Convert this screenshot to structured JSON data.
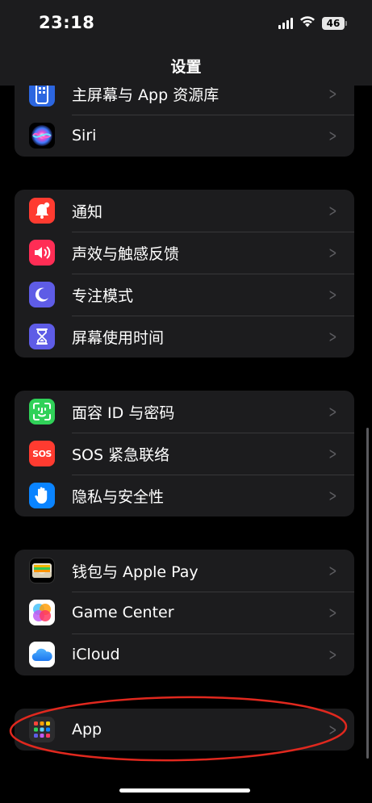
{
  "status_bar": {
    "time": "23:18",
    "battery": "46"
  },
  "nav": {
    "title": "设置"
  },
  "groups": [
    {
      "items": [
        {
          "label": "主屏幕与 App 资源库",
          "icon": "home-screen-icon",
          "color": "#2c66e0"
        },
        {
          "label": "Siri",
          "icon": "siri-icon",
          "color": "#000000"
        }
      ]
    },
    {
      "items": [
        {
          "label": "通知",
          "icon": "bell-icon",
          "color": "#ff3b30"
        },
        {
          "label": "声效与触感反馈",
          "icon": "speaker-icon",
          "color": "#ff2d55"
        },
        {
          "label": "专注模式",
          "icon": "moon-icon",
          "color": "#5e5ce6"
        },
        {
          "label": "屏幕使用时间",
          "icon": "hourglass-icon",
          "color": "#5e5ce6"
        }
      ]
    },
    {
      "items": [
        {
          "label": "面容 ID 与密码",
          "icon": "face-id-icon",
          "color": "#30d158"
        },
        {
          "label": "SOS 紧急联络",
          "icon": "sos-icon",
          "color": "#ff3b30",
          "icon_text": "SOS"
        },
        {
          "label": "隐私与安全性",
          "icon": "hand-icon",
          "color": "#0a84ff"
        }
      ]
    },
    {
      "items": [
        {
          "label": "钱包与 Apple Pay",
          "icon": "wallet-icon",
          "color": "#000000"
        },
        {
          "label": "Game Center",
          "icon": "game-center-icon",
          "color": "#ffffff"
        },
        {
          "label": "iCloud",
          "icon": "cloud-icon",
          "color": "#ffffff"
        }
      ]
    },
    {
      "items": [
        {
          "label": "App",
          "icon": "app-grid-icon",
          "color": "#2c2c2e"
        }
      ]
    }
  ],
  "annotation": {
    "color": "#e0281e"
  }
}
